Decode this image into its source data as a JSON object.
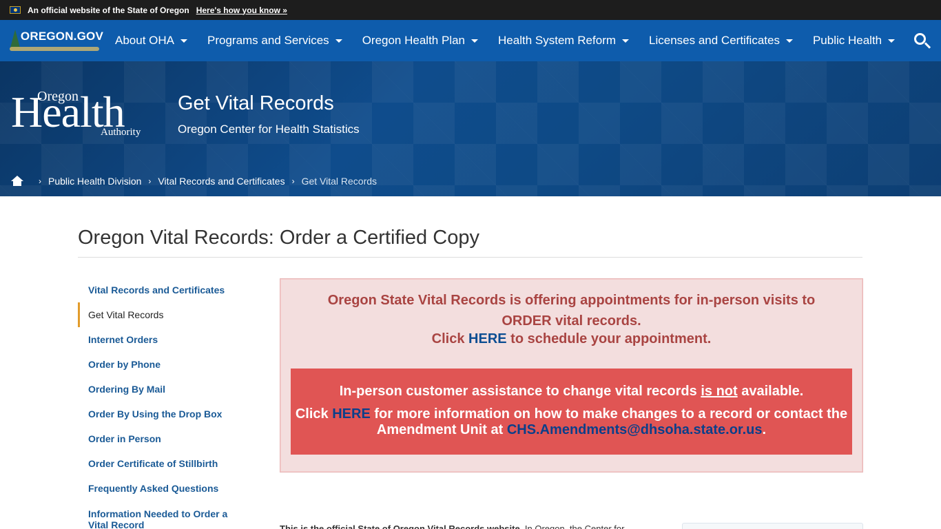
{
  "banner": {
    "official_text": "An official website of the State of Oregon",
    "howto_link": "Here's how you know »"
  },
  "nav": {
    "logo_text": "OREGON.GOV",
    "items": [
      {
        "label": "About OHA"
      },
      {
        "label": "Programs and Services"
      },
      {
        "label": "Oregon Health Plan"
      },
      {
        "label": "Health System Reform"
      },
      {
        "label": "Licenses and Certificates"
      },
      {
        "label": "Public Health"
      }
    ]
  },
  "hero": {
    "logo_oregon": "Oregon",
    "logo_health": "Health",
    "logo_authority": "Authority",
    "title": "Get Vital Records",
    "subtitle": "Oregon Center for Health Statistics"
  },
  "breadcrumb": {
    "items": [
      "Public Health Division",
      "Vital Records and Certificates"
    ],
    "current": "Get Vital Records"
  },
  "page": {
    "title": "Oregon Vital Records: Order a Certified Copy"
  },
  "sidenav": {
    "items": [
      {
        "label": "Vital Records and Certificates"
      },
      {
        "label": "Get Vital Records"
      },
      {
        "label": "Internet Orders"
      },
      {
        "label": "Order by Phone"
      },
      {
        "label": "Ordering By Mail"
      },
      {
        "label": "Order By Using the Drop Box"
      },
      {
        "label": "Order in Person"
      },
      {
        "label": "Order Certificate of Stillbirth"
      },
      {
        "label": "Frequently Asked Questions"
      },
      {
        "label": "Information Needed to Order a Vital Record"
      }
    ]
  },
  "alert": {
    "line1": "Oregon State Vital Records is offering appointments for in-person visits to ORDER vital records.",
    "line2_pre": "Click ",
    "line2_link": "HERE",
    "line2_post": " to schedule your appointment.",
    "inner_r1_pre": "In-person customer assistance to change vital records ",
    "inner_r1_u": "is not",
    "inner_r1_post": " available.",
    "inner_r2_pre": "Click ",
    "inner_r2_link": "HERE",
    "inner_r2_mid": " for more information on how to make changes to a record or contact the Amendment Unit at ",
    "inner_r2_email": "CHS.Amendments@dhsoha.state.or.us",
    "inner_r2_post": "."
  },
  "body": {
    "intro_bold": "This is the official State of Oregon Vital Records website.",
    "intro_rest": " In Oregon, the Center for"
  },
  "colors": {
    "nav_bg": "#0e5cac",
    "banner_bg": "#1d1d1d",
    "alert_bg": "#f3dede",
    "alert_text": "#a94442",
    "alert_inner_bg": "#e05554",
    "active_accent": "#e29c2b"
  }
}
